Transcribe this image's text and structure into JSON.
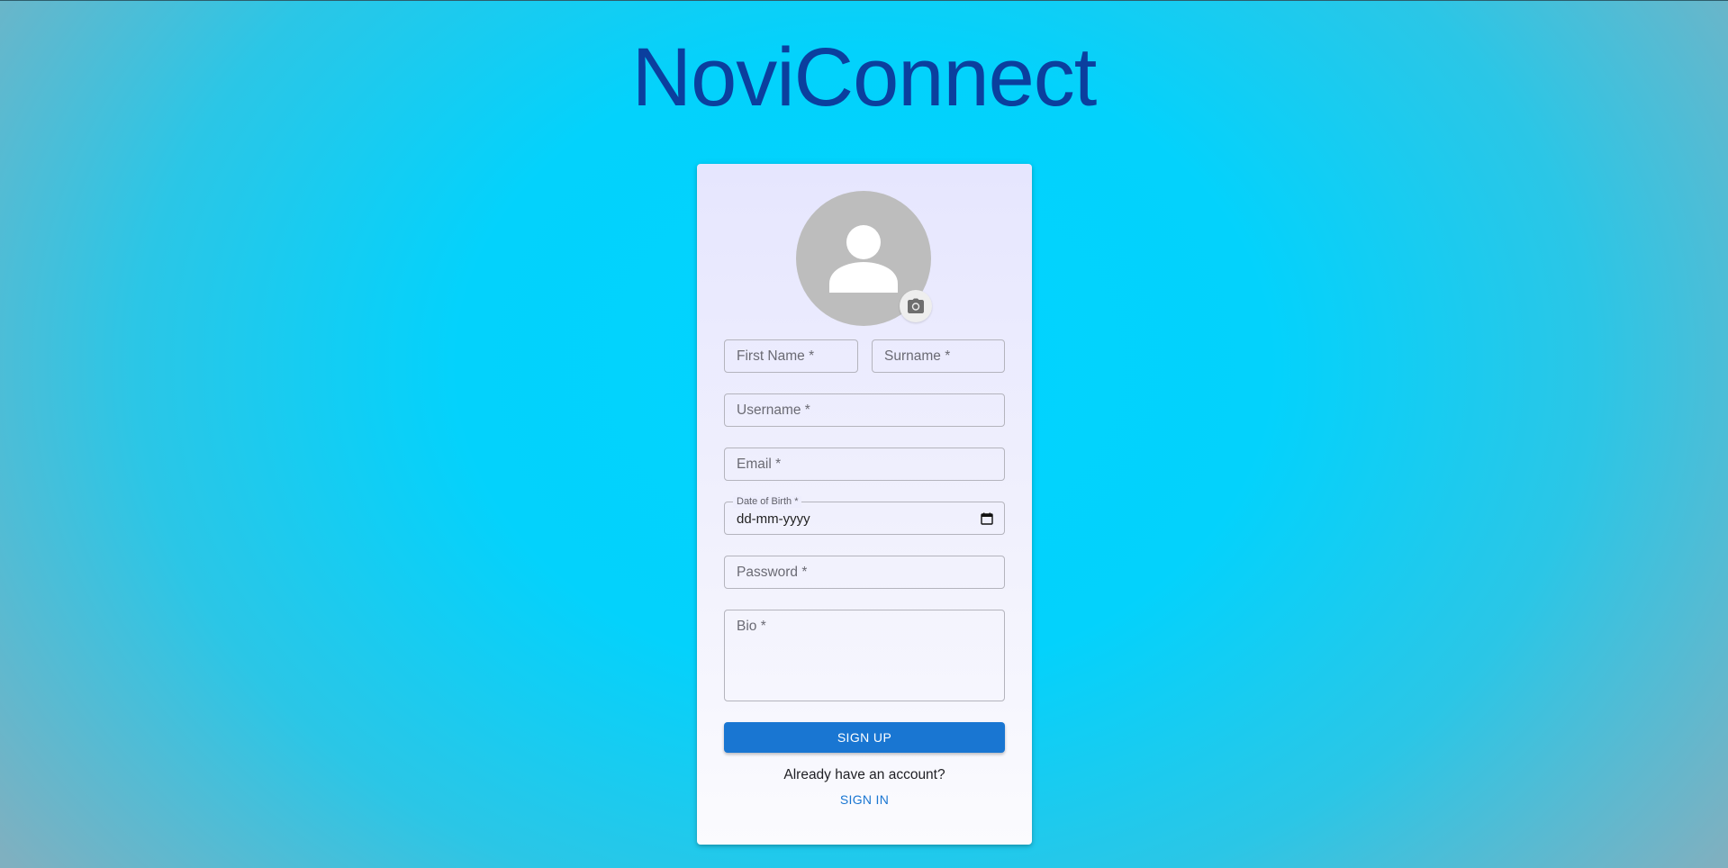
{
  "app": {
    "title": "NoviConnect"
  },
  "form": {
    "avatar_icon": "person-icon",
    "camera_icon": "camera-icon",
    "first_name": {
      "placeholder": "First Name *",
      "value": ""
    },
    "surname": {
      "placeholder": "Surname *",
      "value": ""
    },
    "username": {
      "placeholder": "Username *",
      "value": ""
    },
    "email": {
      "placeholder": "Email *",
      "value": ""
    },
    "date_of_birth": {
      "label": "Date of Birth *",
      "value": "dd-mm-yyyy",
      "icon": "calendar-icon"
    },
    "password": {
      "placeholder": "Password *",
      "value": ""
    },
    "bio": {
      "placeholder": "Bio *",
      "value": ""
    },
    "submit_label": "SIGN UP"
  },
  "footer": {
    "prompt": "Already have an account?",
    "signin_label": "SIGN IN"
  },
  "colors": {
    "title": "#0b3f9e",
    "primary": "#1976d2",
    "background_center": "#00d4ff",
    "background_edge": "#7fb0c0"
  }
}
